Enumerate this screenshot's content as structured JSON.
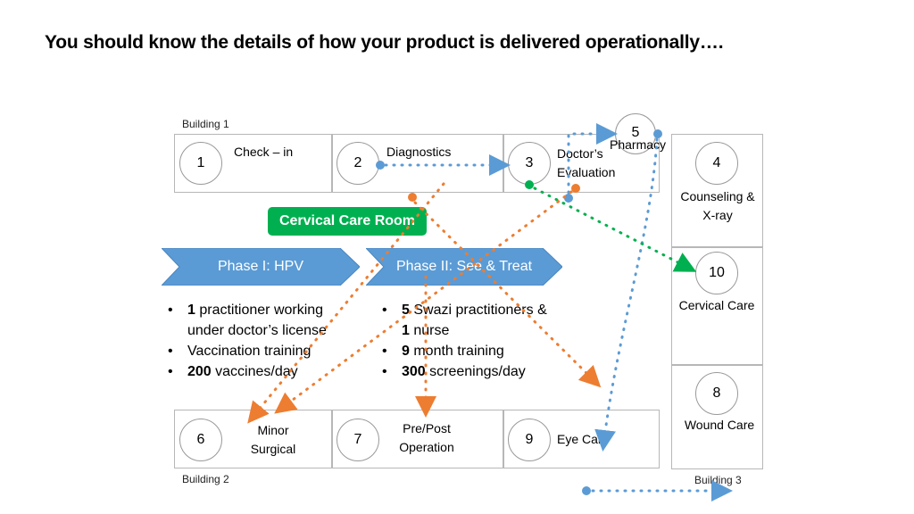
{
  "title": "You should know the details of how your product is delivered operationally….",
  "buildings": {
    "b1": "Building 1",
    "b2": "Building 2",
    "b3": "Building 3"
  },
  "rooms": {
    "r1": {
      "num": "1",
      "label": "Check – in"
    },
    "r2": {
      "num": "2",
      "label": "Diagnostics"
    },
    "r3": {
      "num": "3",
      "label": "Doctor’s Evaluation"
    },
    "r4": {
      "num": "4",
      "label": "Counseling & X-ray"
    },
    "r5": {
      "num": "5",
      "label": "Pharmacy"
    },
    "r6": {
      "num": "6",
      "label": "Minor Surgical"
    },
    "r7": {
      "num": "7",
      "label": "Pre/Post Operation"
    },
    "r8": {
      "num": "8",
      "label": "Wound Care"
    },
    "r9": {
      "num": "9",
      "label": "Eye Care"
    },
    "r10": {
      "num": "10",
      "label": "Cervical Care"
    }
  },
  "cervical_room": "Cervical Care Room",
  "phases": {
    "p1": "Phase I: HPV",
    "p2": "Phase II: See & Treat"
  },
  "phase1_bullets": [
    {
      "bold": "1",
      "text": " practitioner working"
    },
    {
      "bold": "",
      "text": "under doctor’s license"
    },
    {
      "bold": "",
      "text": "Vaccination training"
    },
    {
      "bold": "200",
      "text": " vaccines/day"
    }
  ],
  "phase2_bullets": [
    {
      "bold": "5",
      "text": " Swazi practitioners &"
    },
    {
      "bold": "1",
      "text": " nurse"
    },
    {
      "bold": "9",
      "text": " month training"
    },
    {
      "bold": "300",
      "text": " screenings/day"
    }
  ],
  "colors": {
    "blue_path": "#5b9bd5",
    "orange_path": "#ed7d31",
    "green_path": "#00b050",
    "chevron": "#5b9bd5",
    "button": "#00b050"
  }
}
